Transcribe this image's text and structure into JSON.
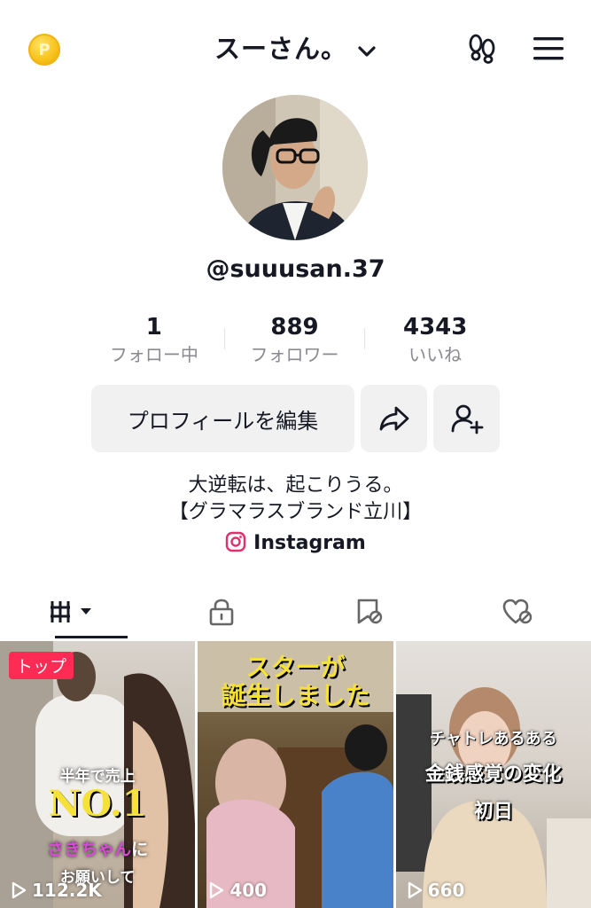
{
  "header": {
    "username": "スーさん。",
    "coin_letter": "P"
  },
  "profile": {
    "handle": "@suuusan.37",
    "stats": [
      {
        "value": "1",
        "label": "フォロー中"
      },
      {
        "value": "889",
        "label": "フォロワー"
      },
      {
        "value": "4343",
        "label": "いいね"
      }
    ],
    "edit_button": "プロフィールを編集",
    "bio_line1": "大逆転は、起こりうる。",
    "bio_line2": "【グラマラスブランド立川】",
    "instagram_label": "Instagram"
  },
  "tabs": [
    {
      "icon": "videos-grid-icon"
    },
    {
      "icon": "lock-icon"
    },
    {
      "icon": "bookmark-icon"
    },
    {
      "icon": "liked-heart-icon"
    }
  ],
  "videos": [
    {
      "badge": "トップ",
      "views": "112.2K",
      "caption_small": "半年で売上",
      "caption_big": "NO.1",
      "caption_pink": "さきちゃん",
      "caption_tail": "に",
      "caption_bottom": "お願いして"
    },
    {
      "views": "400",
      "caption_line1": "スターが",
      "caption_line2": "誕生しました"
    },
    {
      "views": "660",
      "caption_line1": "チャトレあるある",
      "caption_line2": "金銭感覚の変化",
      "caption_line3": "初日"
    }
  ],
  "colors": {
    "accent_red": "#fe2c55",
    "text": "#161823",
    "muted": "#8a8b91",
    "button_bg": "#f1f1f2",
    "caption_yellow": "#f5e13a"
  }
}
